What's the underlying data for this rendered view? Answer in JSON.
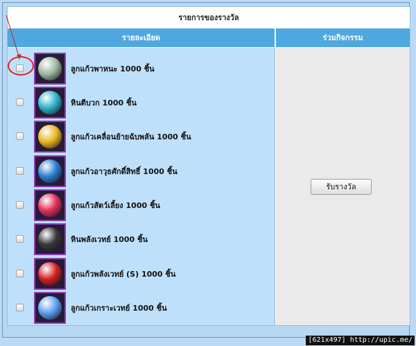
{
  "panel": {
    "title": "รายการของรางวัล",
    "col_detail": "รายละเอียด",
    "col_join": "ร่วมกิจกรรม"
  },
  "rewards": [
    {
      "label": "ลูกแก้วพาหนะ 1000 ชิ้น",
      "icon": "pearl-orb-icon",
      "color": "#9fb89f"
    },
    {
      "label": "หินตีบวก 1000 ชิ้น",
      "icon": "enhance-stone-icon",
      "color": "#2fb4c8"
    },
    {
      "label": "ลูกแก้วเคลื่อนย้ายฉับพลัน 1000 ชิ้น",
      "icon": "teleport-orb-icon",
      "color": "#e8b820"
    },
    {
      "label": "ลูกแก้วอาวุธศักดิ์สิทธิ์ 1000 ชิ้น",
      "icon": "holy-weapon-orb-icon",
      "color": "#2a7fd0"
    },
    {
      "label": "ลูกแก้วสัตว์เลี้ยง 1000 ชิ้น",
      "icon": "pet-orb-icon",
      "color": "#e0305a"
    },
    {
      "label": "หินพลังเวทย์ 1000 ชิ้น",
      "icon": "magic-stone-icon",
      "color": "#3a3a3a"
    },
    {
      "label": "ลูกแก้วพลังเวทย์ (S) 1000 ชิ้น",
      "icon": "magic-orb-s-icon",
      "color": "#d42020"
    },
    {
      "label": "ลูกแก้วเกราะเวทย์ 1000 ชิ้น",
      "icon": "magic-armor-orb-icon",
      "color": "#5aa0f0"
    }
  ],
  "claim_button": "รับรางวัล",
  "watermark": "[621x497] http://upic.me/"
}
